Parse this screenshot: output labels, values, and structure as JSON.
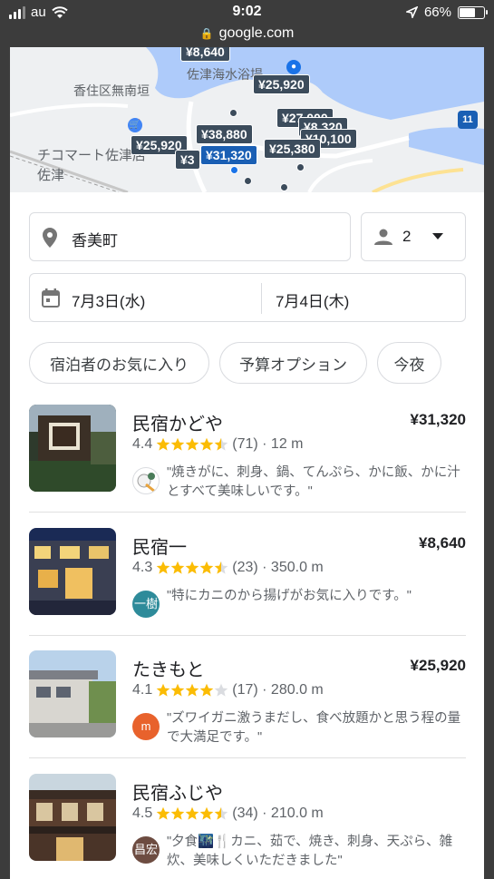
{
  "status_bar": {
    "carrier": "au",
    "time": "9:02",
    "battery": "66%",
    "battery_level": 0.66
  },
  "browser": {
    "url": "google.com"
  },
  "map": {
    "labels": {
      "place1": "香住区無南垣",
      "place2": "佐津海水浴場",
      "place3": "チコマート佐津店",
      "station": "佐津",
      "route": "11"
    },
    "pins": [
      "¥8,640",
      "¥25,920",
      "¥27,000",
      "¥38,880",
      "¥25,920",
      "¥31,320",
      "¥25,380",
      "¥3",
      "¥8,320",
      "¥10,100"
    ]
  },
  "search": {
    "location": "香美町",
    "guests": "2",
    "checkin": "7月3日(水)",
    "checkout": "7月4日(木)"
  },
  "chips": [
    "宿泊者のお気に入り",
    "予算オプション",
    "今夜"
  ],
  "results": [
    {
      "name": "民宿かどや",
      "price": "¥31,320",
      "rating": "4.4",
      "rating_value": 4.4,
      "reviews": "(71)",
      "distance": "· 12 m",
      "avatar": "",
      "avatar_color": "#ffffff",
      "quote": "\"焼きがに、刺身、鍋、てんぷら、かに飯、かに汁とすべて美味しいです。\""
    },
    {
      "name": "民宿一",
      "price": "¥8,640",
      "rating": "4.3",
      "rating_value": 4.3,
      "reviews": "(23)",
      "distance": "· 350.0 m",
      "avatar": "一樹",
      "avatar_color": "#2e8b9a",
      "quote": "\"特にカニのから揚げがお気に入りです。\""
    },
    {
      "name": "たきもと",
      "price": "¥25,920",
      "rating": "4.1",
      "rating_value": 4.1,
      "reviews": "(17)",
      "distance": "· 280.0 m",
      "avatar": "m",
      "avatar_color": "#e8622c",
      "quote": "\"ズワイガニ激うまだし、食べ放題かと思う程の量で大満足です。\""
    },
    {
      "name": "民宿ふじや",
      "price": "",
      "rating": "4.5",
      "rating_value": 4.5,
      "reviews": "(34)",
      "distance": "· 210.0 m",
      "avatar": "昌宏",
      "avatar_color": "#6d4c41",
      "quote": "\"夕食🌃🍴カニ、茹で、焼き、刺身、天ぷら、雑炊、美味しくいただきました\""
    }
  ],
  "colors": {
    "star": "#fbbc04",
    "star_empty": "#dadce0",
    "accent": "#1a73e8"
  }
}
